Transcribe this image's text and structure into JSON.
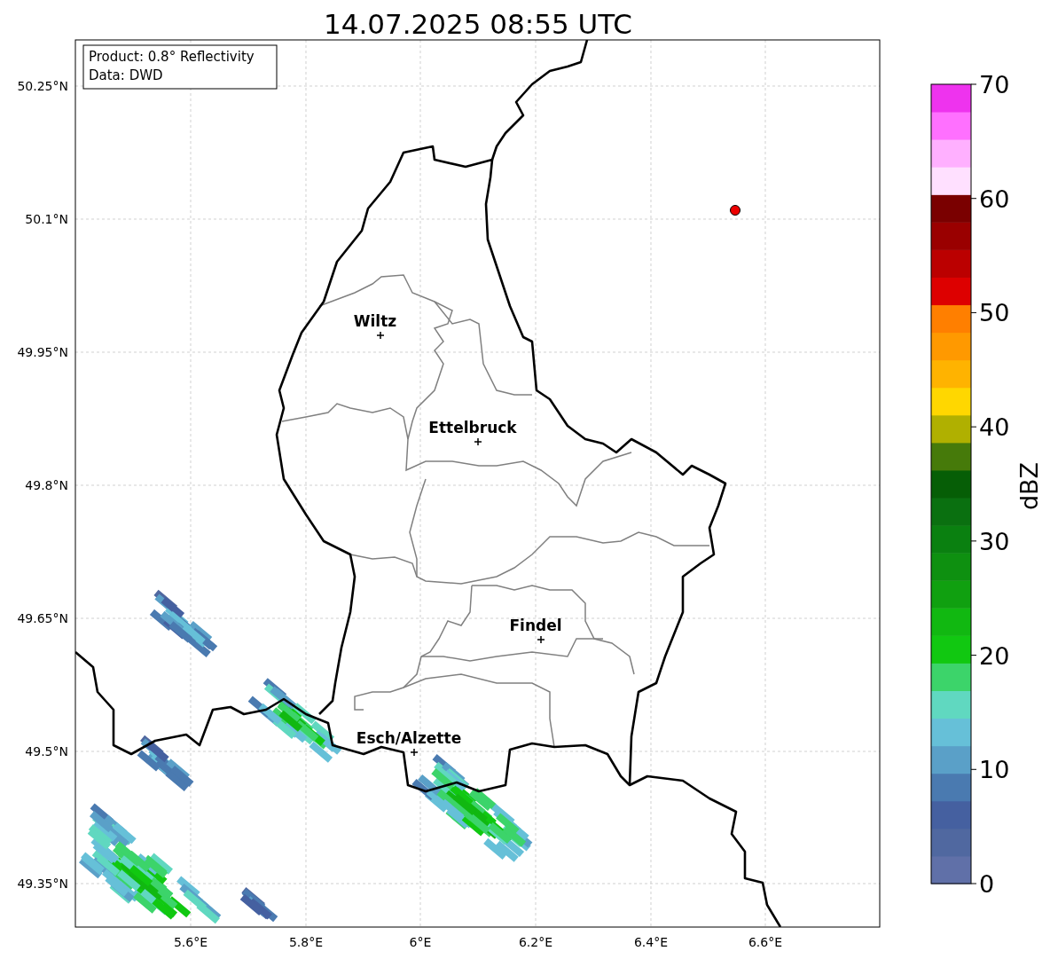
{
  "title": "14.07.2025 08:55 UTC",
  "info_box": [
    "Product: 0.8° Reflectivity",
    "Data: DWD"
  ],
  "lat_ticks": [
    "50.25°N",
    "50.1°N",
    "49.95°N",
    "49.8°N",
    "49.65°N",
    "49.5°N",
    "49.35°N"
  ],
  "lon_ticks": [
    "5.6°E",
    "5.8°E",
    "6°E",
    "6.2°E",
    "6.4°E",
    "6.6°E"
  ],
  "cities": [
    {
      "name": "Wiltz"
    },
    {
      "name": "Ettelbruck"
    },
    {
      "name": "Findel"
    },
    {
      "name": "Esch/Alzette"
    }
  ],
  "colorbar": {
    "label": "dBZ",
    "ticks": [
      "70",
      "60",
      "50",
      "40",
      "30",
      "20",
      "10",
      "0"
    ],
    "bins": [
      {
        "color": "#6070a8"
      },
      {
        "color": "#5068a0"
      },
      {
        "color": "#4560a0"
      },
      {
        "color": "#4a7ab0"
      },
      {
        "color": "#5aa0c8"
      },
      {
        "color": "#66c0d8"
      },
      {
        "color": "#60d8c0"
      },
      {
        "color": "#3cd46a"
      },
      {
        "color": "#11c811"
      },
      {
        "color": "#11b811"
      },
      {
        "color": "#10a010"
      },
      {
        "color": "#0e9010"
      },
      {
        "color": "#0a8010"
      },
      {
        "color": "#0a7010"
      },
      {
        "color": "#065e06"
      },
      {
        "color": "#467a0a"
      },
      {
        "color": "#b0b000"
      },
      {
        "color": "#ffd700"
      },
      {
        "color": "#ffb300"
      },
      {
        "color": "#ff9900"
      },
      {
        "color": "#ff7f00"
      },
      {
        "color": "#dd0000"
      },
      {
        "color": "#bb0000"
      },
      {
        "color": "#9a0000"
      },
      {
        "color": "#7a0000"
      },
      {
        "color": "#ffe0ff"
      },
      {
        "color": "#ffb0ff"
      },
      {
        "color": "#ff70ff"
      },
      {
        "color": "#ee33ee"
      }
    ]
  }
}
